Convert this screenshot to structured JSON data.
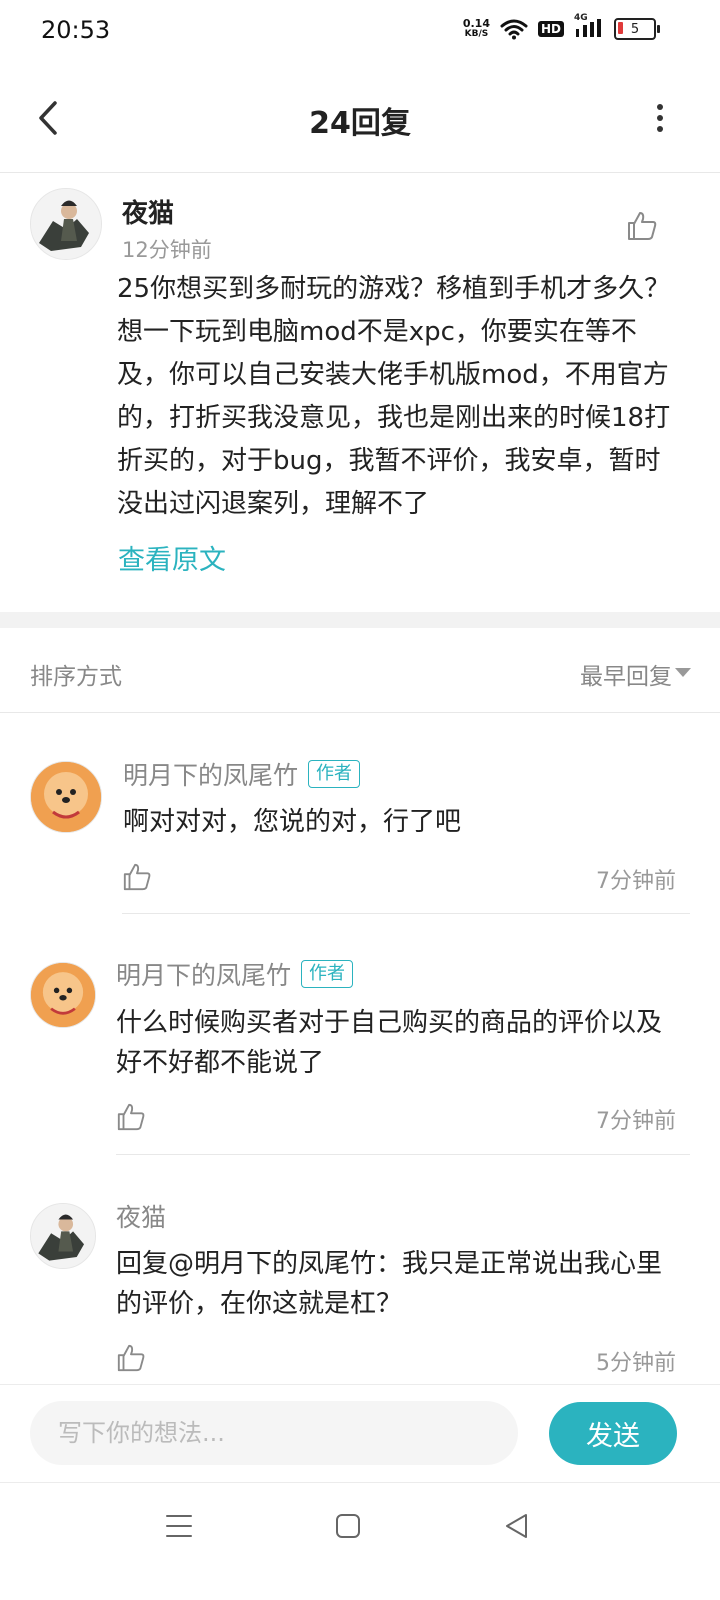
{
  "status_bar": {
    "time": "20:53",
    "net_speed_value": "0.14",
    "net_speed_unit": "KB/S",
    "hd_label": "HD",
    "network_label": "4G",
    "battery_level": "5"
  },
  "header": {
    "title": "24回复"
  },
  "original_post": {
    "author": "夜猫",
    "time": "12分钟前",
    "content": "25你想买到多耐玩的游戏？移植到手机才多久？想一下玩到电脑mod不是xpc，你要实在等不及，你可以自己安装大佬手机版mod，不用官方的，打折买我没意见，我也是刚出来的时候18打折买的，对于bug，我暂不评价，我安卓，暂时没出过闪退案列，理解不了",
    "view_original": "查看原文"
  },
  "sort": {
    "label": "排序方式",
    "value": "最早回复"
  },
  "replies": [
    {
      "author": "明月下的凤尾竹",
      "badge": "作者",
      "content": "啊对对对，您说的对，行了吧",
      "time": "7分钟前"
    },
    {
      "author": "明月下的凤尾竹",
      "badge": "作者",
      "content": "什么时候购买者对于自己购买的商品的评价以及好不好都不能说了",
      "time": "7分钟前"
    },
    {
      "author": "夜猫",
      "content": "回复@明月下的凤尾竹：我只是正常说出我心里的评价，在你这就是杠？",
      "time": "5分钟前"
    }
  ],
  "composer": {
    "placeholder": "写下你的想法...",
    "send_label": "发送"
  },
  "colors": {
    "accent": "#2bb3bf",
    "muted_text": "#999999",
    "divider": "#e8e8e8"
  },
  "icons": {
    "back": "chevron-left-icon",
    "more": "more-vertical-icon",
    "like": "thumbs-up-icon",
    "nav_menu": "menu-icon",
    "nav_home": "square-icon",
    "nav_back": "triangle-back-icon"
  }
}
